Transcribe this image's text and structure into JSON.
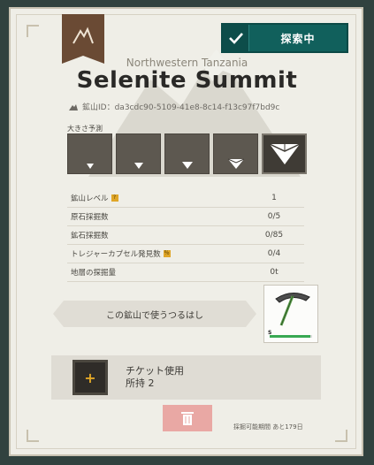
{
  "header": {
    "explore_status": "探索中",
    "region": "Northwestern Tanzania",
    "title": "Selenite Summit",
    "mount_id": "鉱山ID：da3cdc90-5109-41e8-8c14-f13c97f7bd9c"
  },
  "size": {
    "label": "大きさ予測",
    "boxes": [
      "size-xs",
      "size-s",
      "size-m",
      "size-l",
      "size-xl"
    ],
    "selected_index": 4
  },
  "stats": [
    {
      "label": "鉱山レベル",
      "value": "1",
      "badge": "?"
    },
    {
      "label": "原石採掘数",
      "value": "0/5",
      "badge": ""
    },
    {
      "label": "鉱石採掘数",
      "value": "0/85",
      "badge": ""
    },
    {
      "label": "トレジャーカプセル発見数",
      "value": "0/4",
      "badge": "％"
    },
    {
      "label": "地層の探掘量",
      "value": "0t",
      "badge": ""
    }
  ],
  "pickaxe": {
    "label": "この鉱山で使うつるはし",
    "level": "S",
    "durability": 0.95
  },
  "ticket": {
    "plus": "+",
    "title": "チケット使用",
    "owned_label": "所持",
    "owned_count": "2"
  },
  "footer": {
    "days_left": "採掘可能期間 あと179日"
  },
  "colors": {
    "explore_bg": "#11605c",
    "ribbon": "#6a4a34",
    "card": "#efeee7",
    "trash": "#e9a8a4"
  }
}
